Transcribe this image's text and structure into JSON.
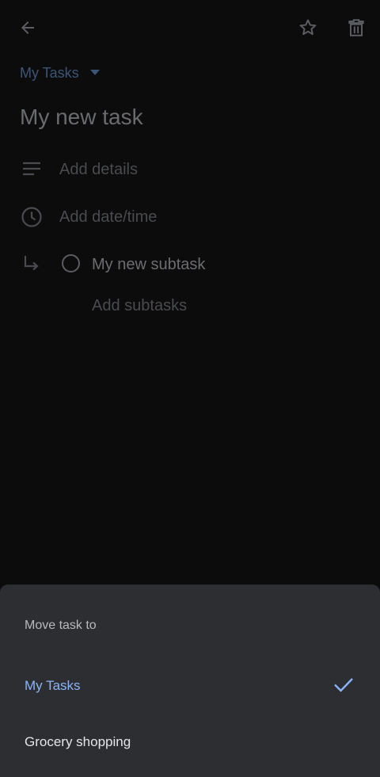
{
  "task": {
    "list_name": "My Tasks",
    "title": "My new task",
    "details_placeholder": "Add details",
    "datetime_placeholder": "Add date/time",
    "subtask_title": "My new subtask",
    "add_subtasks_label": "Add subtasks"
  },
  "sheet": {
    "title": "Move task to",
    "items": [
      {
        "label": "My Tasks",
        "selected": true
      },
      {
        "label": "Grocery shopping",
        "selected": false
      }
    ]
  },
  "colors": {
    "background": "#0c0c0d",
    "sheet": "#2d2e31",
    "accent": "#8ab4f8"
  }
}
